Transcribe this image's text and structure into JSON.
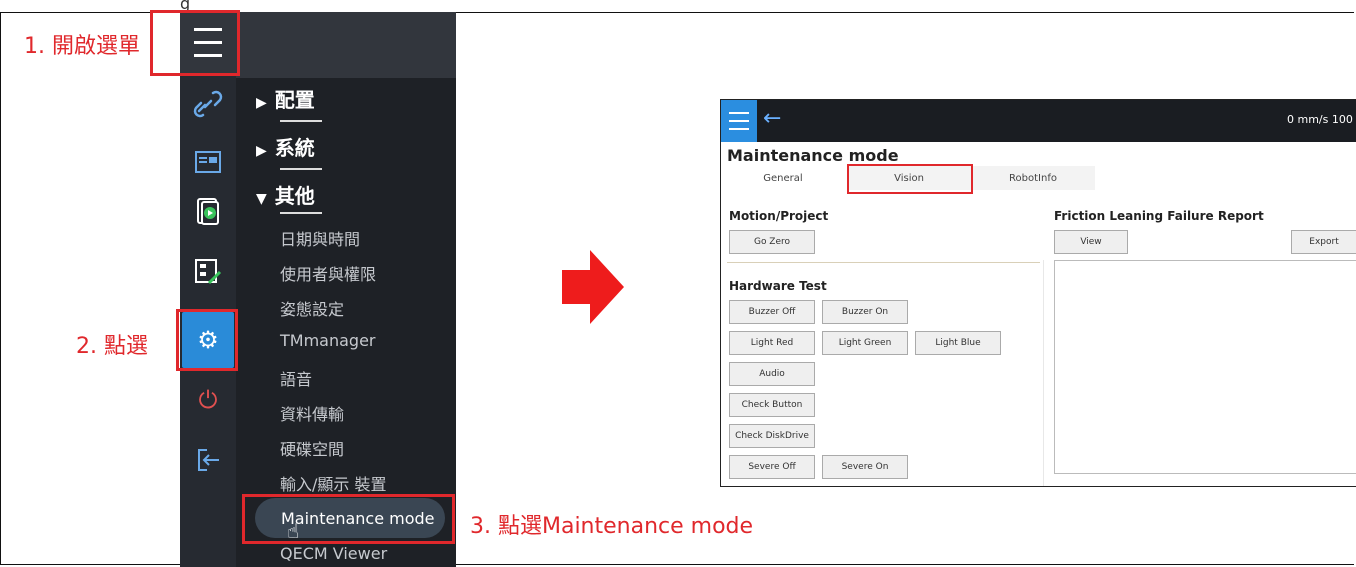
{
  "caption_top": "g",
  "steps": {
    "step1": "1. 開啟選單",
    "step2": "2. 點選",
    "step3": "3. 點選Maintenance mode"
  },
  "sidebar_icons": [
    "link-icon",
    "display-icon",
    "play-document-icon",
    "flow-edit-icon",
    "settings-gear-icon",
    "power-icon",
    "logout-icon"
  ],
  "menu": {
    "sections": [
      {
        "label": "配置",
        "marker": "▶"
      },
      {
        "label": "系統",
        "marker": "▶"
      },
      {
        "label": "其他",
        "marker": "▼"
      }
    ],
    "items": [
      "日期與時間",
      "使用者與權限",
      "姿態設定",
      "TMmanager",
      "語音",
      "資料傳輸",
      "硬碟空間",
      "輸入/顯示 裝置",
      "Maintenance mode",
      "QECM Viewer"
    ]
  },
  "shot": {
    "speed": "0 mm/s 100",
    "title": "Maintenance mode",
    "tabs": [
      "General",
      "Vision",
      "RobotInfo"
    ],
    "motion_title": "Motion/Project",
    "go_zero": "Go Zero",
    "hardware_title": "Hardware Test",
    "buttons": {
      "buzzer_off": "Buzzer Off",
      "buzzer_on": "Buzzer On",
      "light_red": "Light Red",
      "light_green": "Light Green",
      "light_blue": "Light Blue",
      "audio": "Audio",
      "check_button": "Check Button",
      "check_diskdrive": "Check DiskDrive",
      "severe_off": "Severe Off",
      "severe_on": "Severe On"
    },
    "report_title": "Friction Leaning Failure Report",
    "view": "View",
    "export": "Export"
  },
  "colors": {
    "highlight": "#e0282c",
    "accent_blue": "#2a8bd8",
    "menu_bg": "#1e2126"
  }
}
